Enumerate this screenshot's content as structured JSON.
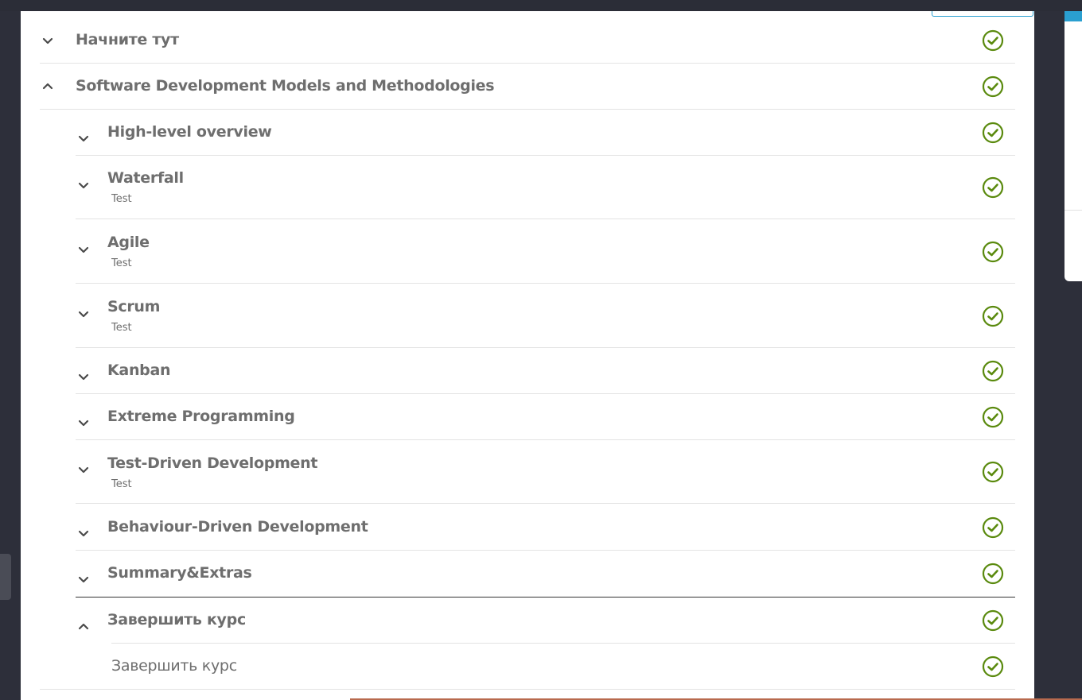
{
  "colors": {
    "check_green": "#5a8a0e",
    "text_gray": "#6e6e6e",
    "accent_blue": "#2a9fd0"
  },
  "outline": [
    {
      "title": "Начните тут",
      "subtitle": "",
      "expanded": false,
      "completed": true
    },
    {
      "title": "Software Development Models and Methodologies",
      "subtitle": "",
      "expanded": true,
      "completed": true
    },
    {
      "title": "High-level overview",
      "subtitle": "",
      "expanded": false,
      "completed": true
    },
    {
      "title": "Waterfall",
      "subtitle": "Test",
      "expanded": false,
      "completed": true
    },
    {
      "title": "Agile",
      "subtitle": "Test",
      "expanded": false,
      "completed": true
    },
    {
      "title": "Scrum",
      "subtitle": "Test",
      "expanded": false,
      "completed": true
    },
    {
      "title": "Kanban",
      "subtitle": "",
      "expanded": false,
      "completed": true
    },
    {
      "title": "Extreme Programming",
      "subtitle": "",
      "expanded": false,
      "completed": true
    },
    {
      "title": "Test-Driven Development",
      "subtitle": "Test",
      "expanded": false,
      "completed": true
    },
    {
      "title": "Behaviour-Driven Development",
      "subtitle": "",
      "expanded": false,
      "completed": true
    },
    {
      "title": "Summary&Extras",
      "subtitle": "",
      "expanded": false,
      "completed": true
    },
    {
      "title": "Завершить курс",
      "subtitle": "",
      "expanded": true,
      "completed": true
    },
    {
      "title": "Завершить курс",
      "subtitle": "",
      "expanded": false,
      "completed": true
    }
  ]
}
